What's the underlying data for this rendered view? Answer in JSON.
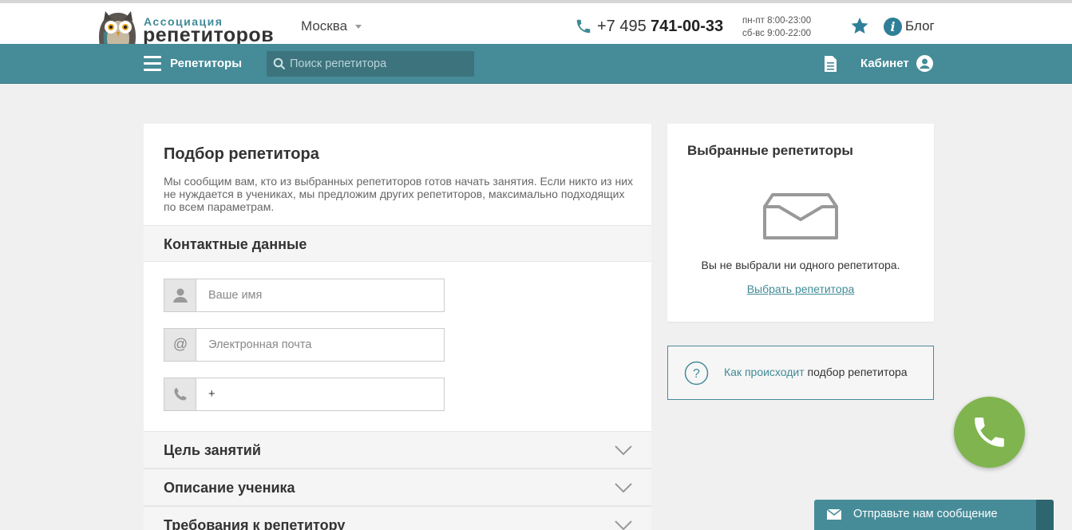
{
  "header": {
    "logo_line1": "Ассоциация",
    "logo_line2": "репетиторов",
    "city": "Москва",
    "phone_prefix": "+7 495",
    "phone_main": "741-00-33",
    "hours_weekdays": "пн-пт 8:00-23:00",
    "hours_weekend": "сб-вс 9:00-22:00",
    "blog": "Блог"
  },
  "nav": {
    "tutors": "Репетиторы",
    "search_placeholder": "Поиск репетитора",
    "cabinet": "Кабинет"
  },
  "form": {
    "title": "Подбор репетитора",
    "description": "Мы сообщим вам, кто из выбранных репетиторов готов начать занятия. Если никто из них не нуждается в учениках, мы предложим других репетиторов, максимально подходящих по всем параметрам.",
    "contacts_title": "Контактные данные",
    "name_placeholder": "Ваше имя",
    "email_placeholder": "Электронная почта",
    "phone_value": "+",
    "sections": [
      "Цель занятий",
      "Описание ученика",
      "Требования к репетитору"
    ]
  },
  "selected": {
    "title": "Выбранные репетиторы",
    "empty_text": "Вы не выбрали ни одного репетитора.",
    "choose_link": "Выбрать репетитора"
  },
  "how": {
    "link_part": "Как происходит",
    "text_part": " подбор репетитора"
  },
  "message_bar": {
    "text": "Отправьте нам сообщение"
  },
  "colors": {
    "teal": "#468b98",
    "green": "#7fb44f",
    "background": "#f0f0f0"
  }
}
